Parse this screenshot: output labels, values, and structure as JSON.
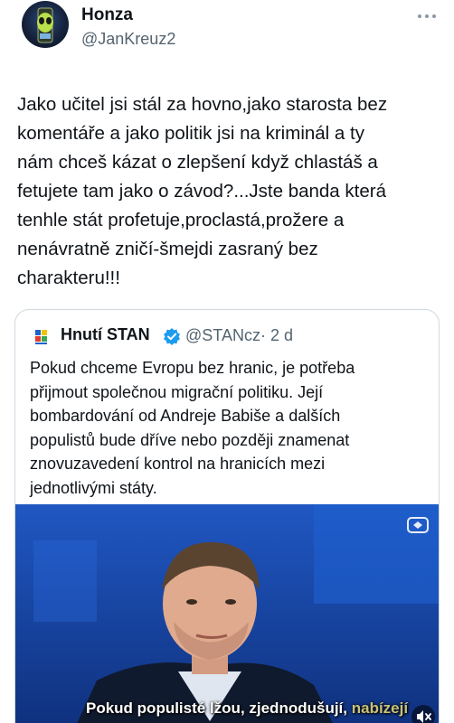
{
  "tweet": {
    "author_name": "Honza",
    "author_handle": "@JanKreuz2",
    "text": "Jako učitel jsi stál za hovno,jako starosta bez\nkomentáře a jako politik jsi na kriminál a ty\nnám chceš kázat o zlepšení když chlastáš a\nfetujete tam jako o závod?...Jste banda která\ntenhle stát profetuje,proclastá,prožere a\nnenávratně zničí-šmejdi zasraný bez\ncharakteru!!!"
  },
  "quote": {
    "author_name": "Hnutí STAN",
    "author_handle": "@STANcz",
    "time": "· 2 d",
    "text": "Pokud chceme Evropu bez hranic, je potřeba\npřijmout společnou migrační politiku. Její\nbombardování od Andreje Babiše a dalších\npopulistů bude dříve nebo později znamenat\nznovuzavedení kontrol na hranicích mezi\njednotlivými státy.",
    "video": {
      "subtitle_main": "Pokud populisté lžou, zjednodušují,",
      "subtitle_dim": "nabízejí"
    }
  },
  "icons": {
    "more": "more-dots-icon",
    "verified": "verified-badge-icon",
    "mute": "speaker-muted-icon",
    "brand_logo": "stan-logo-icon"
  },
  "colors": {
    "text_primary": "#0f1419",
    "text_secondary": "#536471",
    "verified_blue": "#1d9bf0",
    "border": "#cfd9de",
    "video_bg": "#1b4fb0"
  }
}
